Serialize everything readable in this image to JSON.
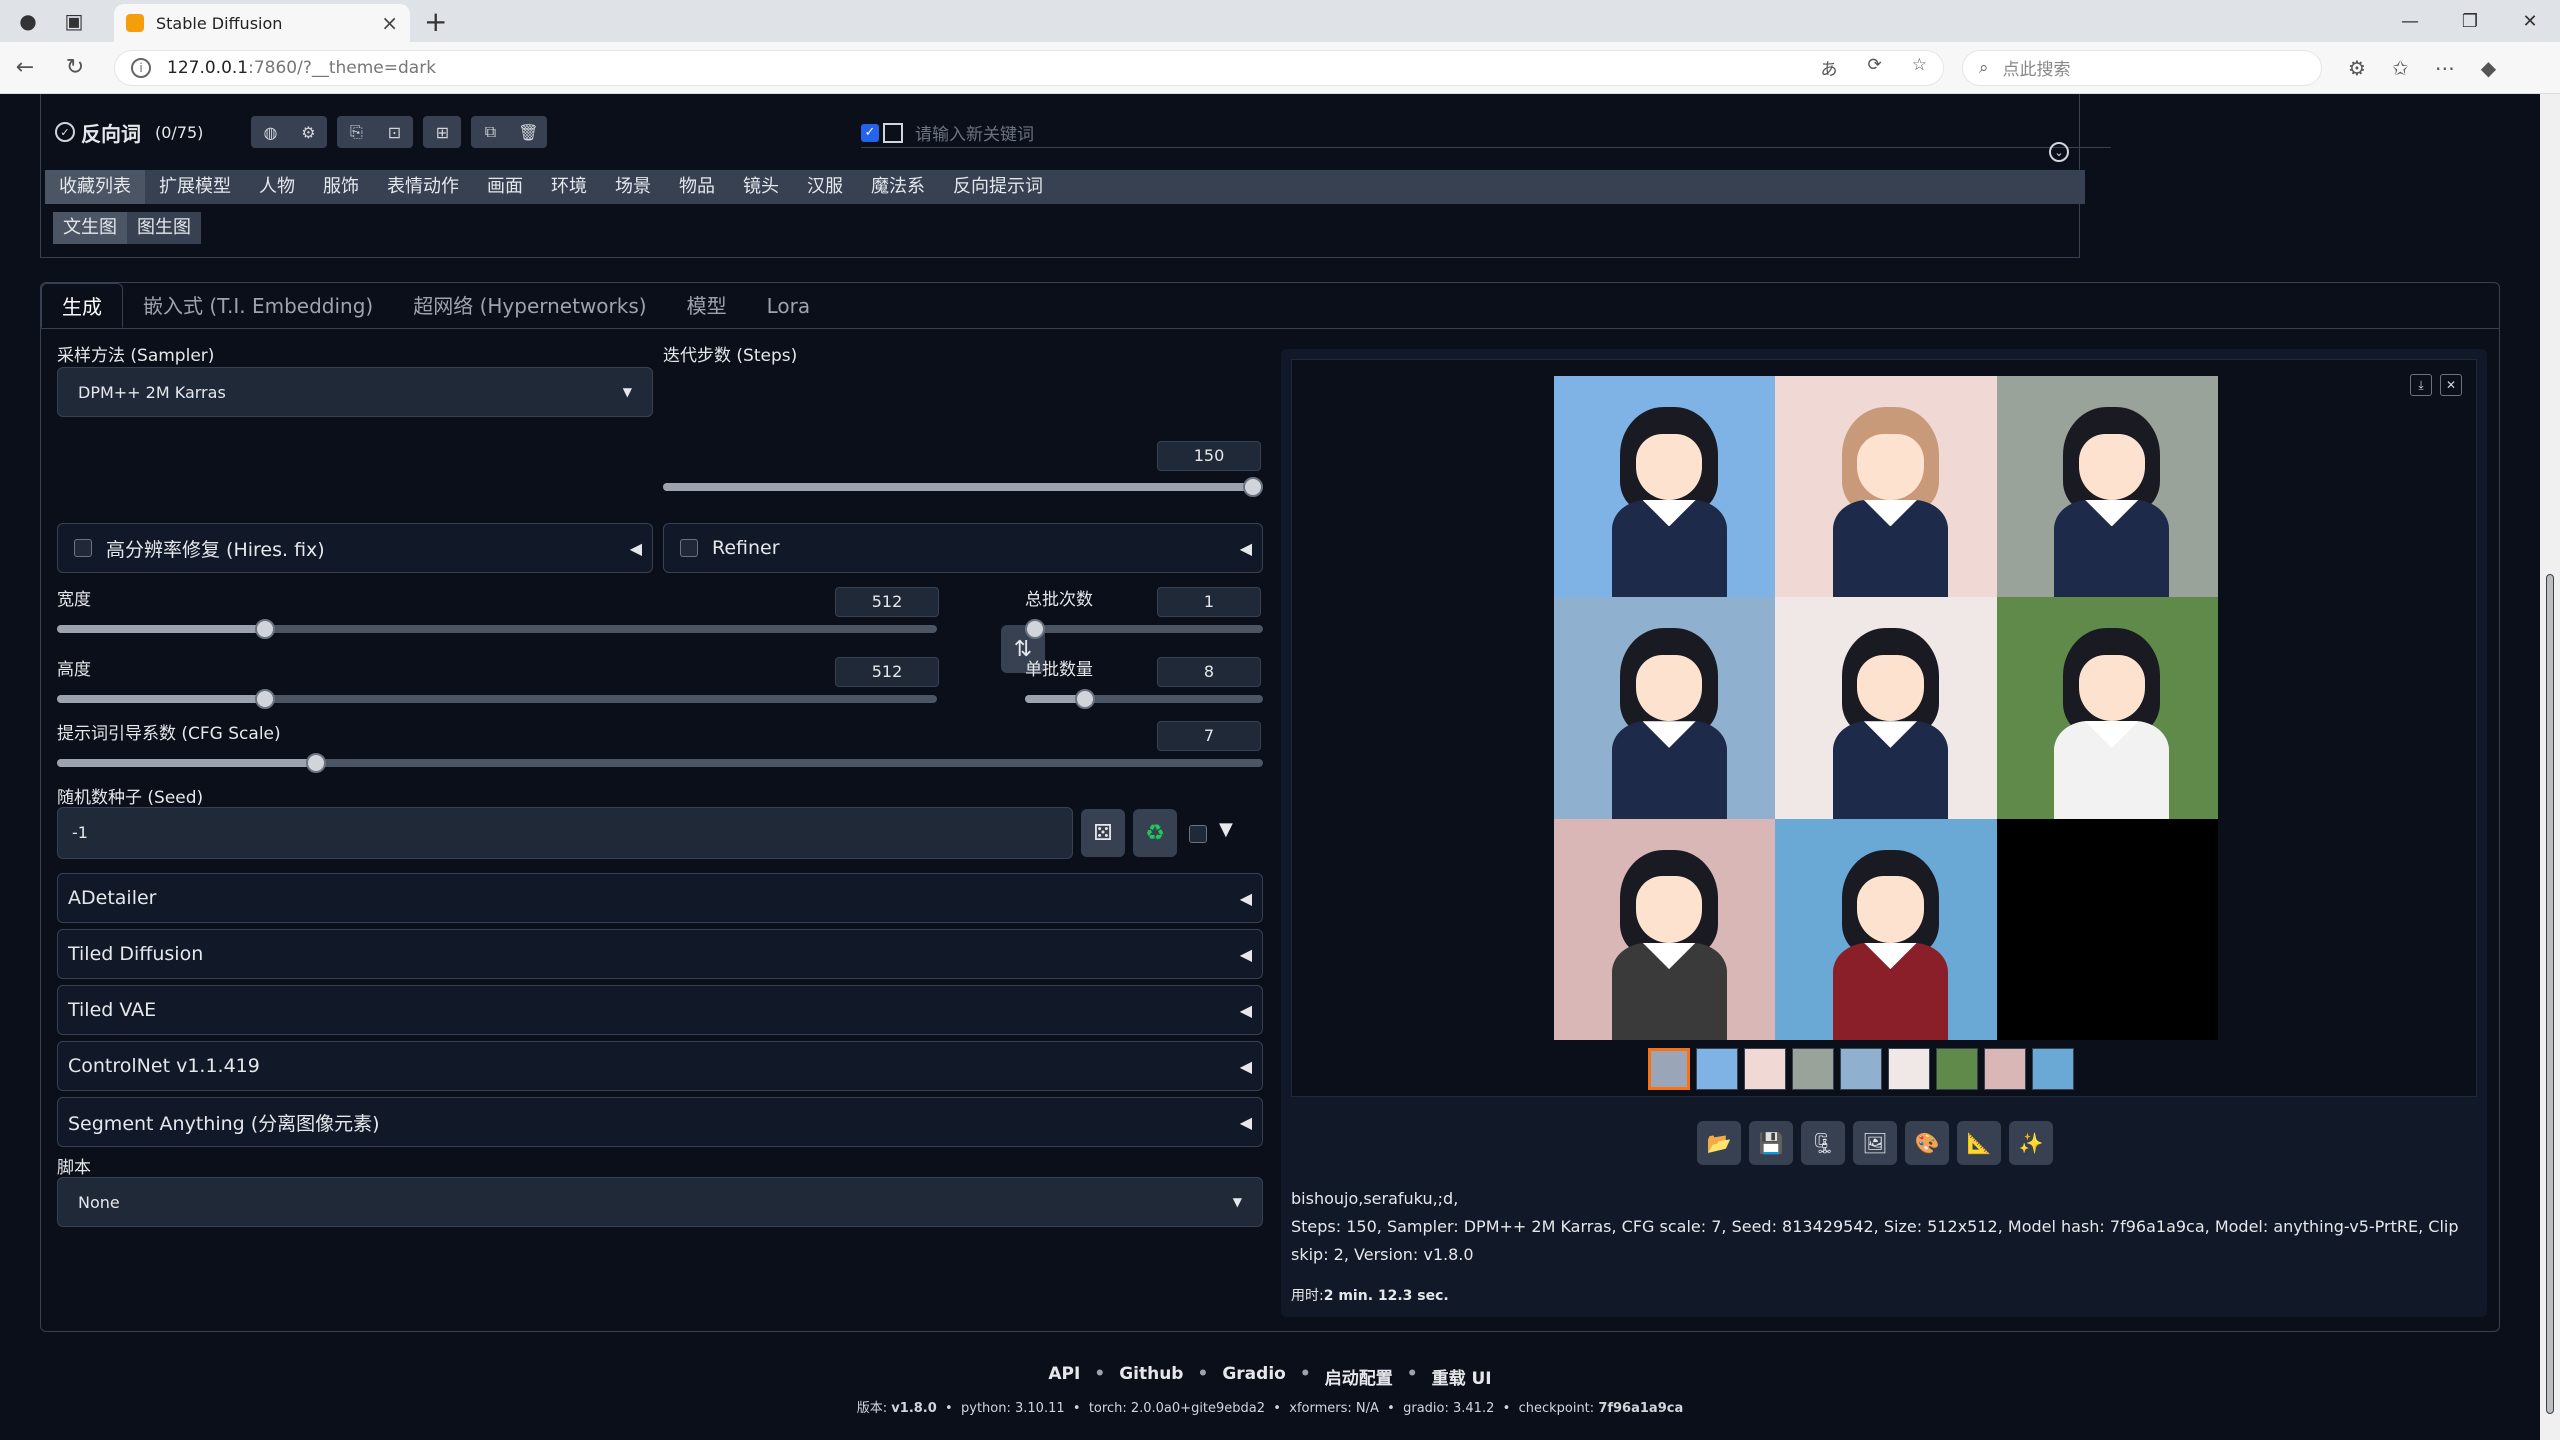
{
  "browser": {
    "tab_title": "Stable Diffusion",
    "url_host": "127.0.0.1",
    "url_path": ":7860/?__theme=dark",
    "search_placeholder": "点此搜索"
  },
  "prompt": {
    "negative_title": "反向词",
    "negative_count": "(0/75)",
    "keyword_placeholder": "请输入新关键词",
    "category_tabs": [
      "收藏列表",
      "扩展模型",
      "人物",
      "服饰",
      "表情动作",
      "画面",
      "环境",
      "场景",
      "物品",
      "镜头",
      "汉服",
      "魔法系",
      "反向提示词"
    ],
    "sub_tabs": [
      "文生图",
      "图生图"
    ]
  },
  "main_tabs": [
    "生成",
    "嵌入式 (T.I. Embedding)",
    "超网络 (Hypernetworks)",
    "模型",
    "Lora"
  ],
  "params": {
    "sampler_label": "采样方法 (Sampler)",
    "sampler_value": "DPM++ 2M Karras",
    "steps_label": "迭代步数 (Steps)",
    "steps_value": "150",
    "steps_fraction": 1.0,
    "hires_label": "高分辨率修复 (Hires. fix)",
    "refiner_label": "Refiner",
    "width_label": "宽度",
    "width_value": "512",
    "width_fraction": 0.23,
    "height_label": "高度",
    "height_value": "512",
    "height_fraction": 0.23,
    "batch_count_label": "总批次数",
    "batch_count_value": "1",
    "batch_count_fraction": 0.0,
    "batch_size_label": "单批数量",
    "batch_size_value": "8",
    "batch_size_fraction": 0.23,
    "cfg_label": "提示词引导系数 (CFG Scale)",
    "cfg_value": "7",
    "cfg_fraction": 0.21,
    "seed_label": "随机数种子 (Seed)",
    "seed_value": "-1",
    "script_label": "脚本",
    "script_value": "None"
  },
  "accordions": [
    "ADetailer",
    "Tiled Diffusion",
    "Tiled VAE",
    "ControlNet v1.1.419",
    "Segment Anything (分离图像元素)"
  ],
  "gallery": {
    "info_prompt": "bishoujo,serafuku,;d,",
    "info_params": "Steps: 150, Sampler: DPM++ 2M Karras, CFG scale: 7, Seed: 813429542, Size: 512x512, Model hash: 7f96a1a9ca, Model: anything-v5-PrtRE, Clip skip: 2, Version: v1.8.0",
    "time_label": "用时:",
    "time_value": "2 min. 12.3 sec."
  },
  "footer": {
    "links": [
      "API",
      "Github",
      "Gradio",
      "启动配置",
      "重载 UI"
    ],
    "version_label": "版本:",
    "version": "v1.8.0",
    "python_label": "python:",
    "python": "3.10.11",
    "torch_label": "torch:",
    "torch": "2.0.0a0+gite9ebda2",
    "xformers_label": "xformers:",
    "xformers": "N/A",
    "gradio_label": "gradio:",
    "gradio": "3.41.2",
    "checkpoint_label": "checkpoint:",
    "checkpoint": "7f96a1a9ca"
  },
  "colors": {
    "background": "#0b0f19",
    "panel": "#111827",
    "input": "#1f2937",
    "border": "#374151",
    "accent_thumb": "#f97316"
  }
}
